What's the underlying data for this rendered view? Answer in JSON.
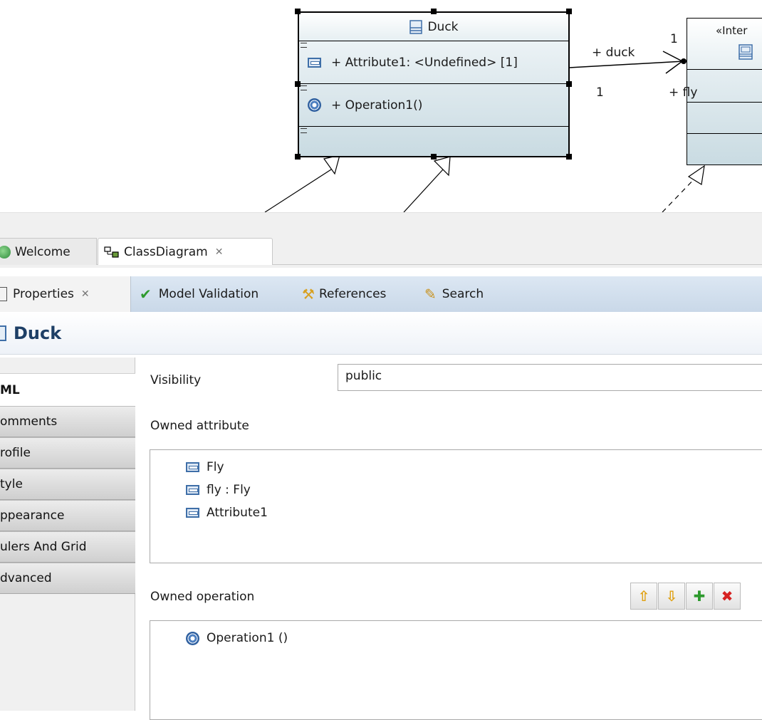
{
  "diagram": {
    "duck_class": {
      "name": "Duck",
      "attribute": "+ Attribute1: <Undefined> [1]",
      "operation": "+ Operation1()"
    },
    "interface_class": {
      "stereotype": "«Inter"
    },
    "association": {
      "end1_role": "+ duck",
      "end1_mult": "1",
      "end2_role": "+ fly",
      "end2_mult": "1"
    }
  },
  "editor_tabs": [
    {
      "label": "Welcome",
      "icon": "welcome-globe-icon"
    },
    {
      "label": "ClassDiagram",
      "icon": "class-diagram-icon",
      "active": true
    }
  ],
  "view_tabs": [
    {
      "label": "Properties",
      "icon": "properties-icon",
      "active": true
    },
    {
      "label": "Model Validation",
      "icon": "checkmark-icon"
    },
    {
      "label": "References",
      "icon": "references-icon"
    },
    {
      "label": "Search",
      "icon": "search-flashlight-icon"
    }
  ],
  "properties": {
    "title": "Duck",
    "categories": [
      "ML",
      "omments",
      "rofile",
      "tyle",
      "ppearance",
      "ulers And Grid",
      "dvanced"
    ],
    "visibility_label": "Visibility",
    "visibility_value": "public",
    "owned_attribute_label": "Owned attribute",
    "owned_attributes": [
      "Fly",
      "fly : Fly",
      "Attribute1"
    ],
    "owned_operation_label": "Owned operation",
    "owned_operations": [
      "Operation1 ()"
    ],
    "toolbar": {
      "up_icon": "arrow-up-icon",
      "down_icon": "arrow-down-icon",
      "add_icon": "plus-icon",
      "delete_icon": "delete-icon"
    }
  },
  "colors": {
    "accent_title": "#1e3f66",
    "view_tab_bg": "#c9d8e8",
    "class_fill": "#c9dbe2",
    "add_green": "#2e9a2e",
    "delete_red": "#d62222",
    "arrow_amber": "#e0a010"
  }
}
